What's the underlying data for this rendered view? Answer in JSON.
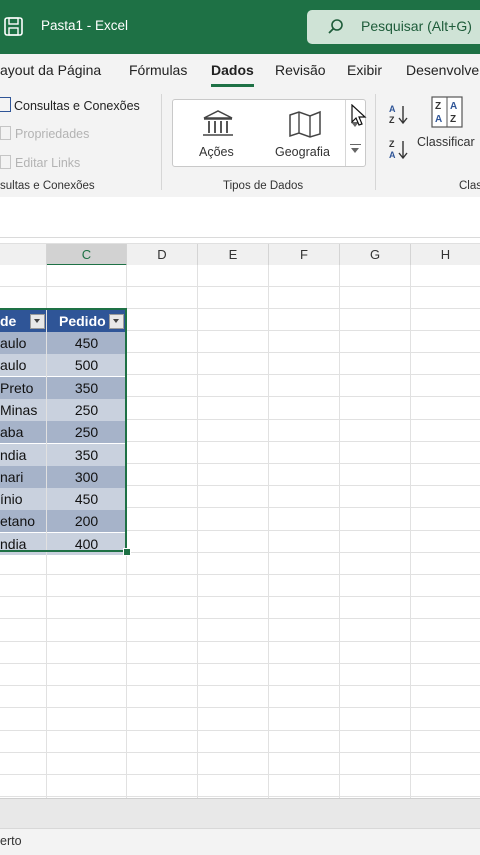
{
  "window": {
    "title": "Pasta1  -  Excel"
  },
  "search": {
    "text": "Pesquisar (Alt+G)"
  },
  "tabs": [
    "ayout da Página",
    "Fórmulas",
    "Dados",
    "Revisão",
    "Exibir",
    "Desenvolve"
  ],
  "active_tab": "Dados",
  "ribbon": {
    "queries": {
      "items": [
        "Consultas e Conexões",
        "Propriedades",
        "Editar Links"
      ],
      "group_label": "sultas e Conexões"
    },
    "data_types": {
      "actions_label": "Ações",
      "geography_label": "Geografia",
      "group_label": "Tipos de Dados"
    },
    "sort": {
      "sort_label": "Classificar",
      "group_label": "Clas"
    }
  },
  "columns": [
    "C",
    "D",
    "E",
    "F",
    "G",
    "H"
  ],
  "selected_column": "C",
  "table": {
    "headers": [
      "de",
      "Pedido"
    ],
    "rows": [
      [
        "aulo",
        "450"
      ],
      [
        "aulo",
        "500"
      ],
      [
        " Preto",
        "350"
      ],
      [
        " Minas",
        "250"
      ],
      [
        "aba",
        "250"
      ],
      [
        "ndia",
        "350"
      ],
      [
        "nari",
        "300"
      ],
      [
        "ínio",
        "450"
      ],
      [
        "etano",
        "200"
      ],
      [
        "ndia",
        "400"
      ]
    ]
  },
  "status": {
    "text": "erto"
  },
  "colors": {
    "excel_green": "#1e7145",
    "table_header": "#2f5597",
    "band_dark": "#a6b3c9",
    "band_light": "#c9d1de"
  }
}
